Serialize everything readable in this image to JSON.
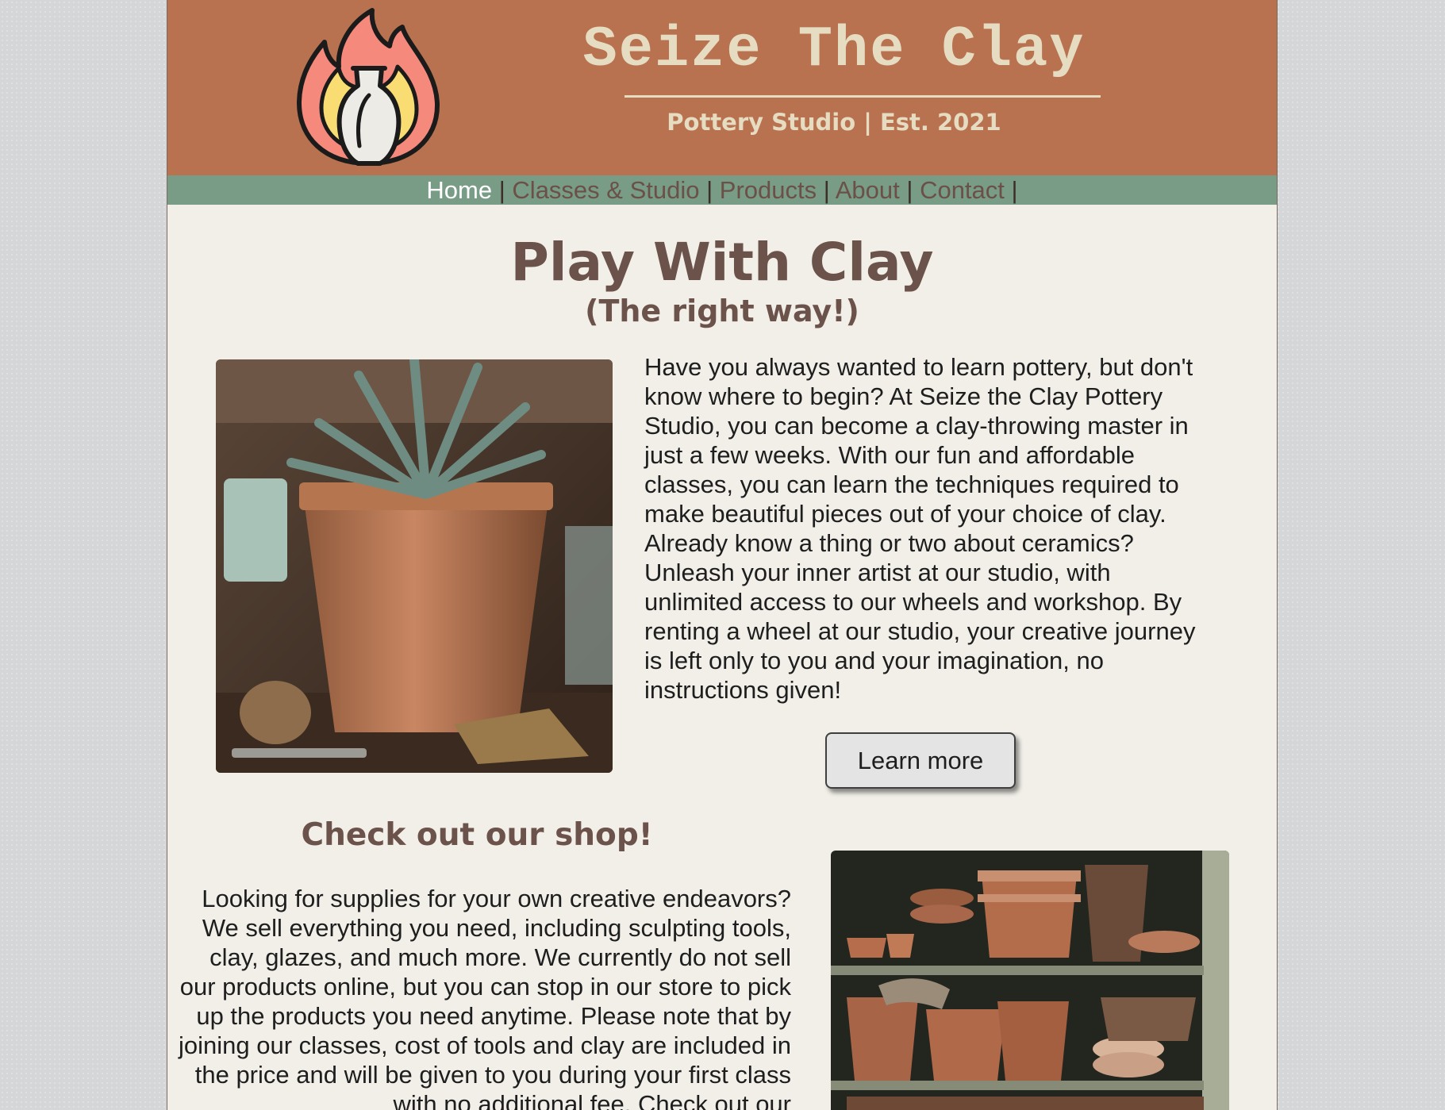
{
  "header": {
    "site_title": "Seize The Clay",
    "tagline": "Pottery Studio | Est. 2021",
    "logo_icon": "flame-vase-icon"
  },
  "nav": {
    "items": [
      {
        "label": "Home",
        "active": true
      },
      {
        "label": "Classes & Studio",
        "active": false
      },
      {
        "label": "Products",
        "active": false
      },
      {
        "label": "About",
        "active": false
      },
      {
        "label": "Contact",
        "active": false
      }
    ],
    "separator": "|"
  },
  "hero": {
    "title": "Play With Clay",
    "subtitle": "(The right way!)",
    "body": "Have you always wanted to learn pottery, but don't know where to begin? At Seize the Clay Pottery Studio, you can become a clay-throwing master in just a few weeks. With our fun and affordable classes, you can learn the techniques required to make beautiful pieces out of your choice of clay. Already know a thing or two about ceramics? Unleash your inner artist at our studio, with unlimited access to our wheels and workshop. By renting a wheel at our studio, your creative journey is left only to you and your imagination, no instructions given!",
    "button_label": "Learn more"
  },
  "shop": {
    "heading": "Check out our shop!",
    "body": "Looking for supplies for your own creative endeavors? We sell everything you need, including sculpting tools, clay, glazes, and much more. We currently do not sell our products online, but you can stop in our store to pick up the products you need anytime. Please note that by joining our classes, cost of tools and clay are included in the price and will be given to you during your first class with no additional fee. Check out our"
  },
  "colors": {
    "header_bg": "#b8724f",
    "nav_bg": "#789c86",
    "page_bg": "#f1efe8",
    "heading_text": "#6b524a",
    "header_text": "#e6dcc2"
  }
}
